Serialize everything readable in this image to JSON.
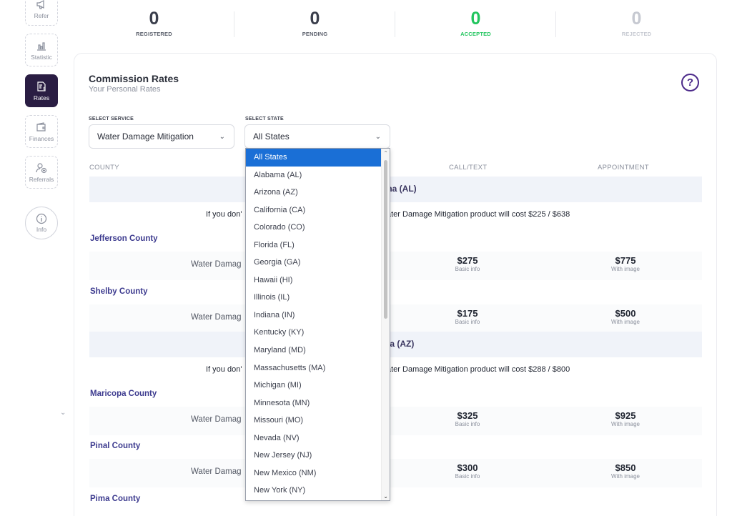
{
  "sidebar": {
    "items": [
      {
        "label": "Refer",
        "icon": "megaphone-icon"
      },
      {
        "label": "Statistic",
        "icon": "bar-chart-icon"
      },
      {
        "label": "Rates",
        "icon": "invoice-dollar-icon"
      },
      {
        "label": "Finances",
        "icon": "wallet-icon"
      },
      {
        "label": "Referrals",
        "icon": "user-add-icon"
      }
    ],
    "info_label": "Info",
    "collapse_glyph": "⌄"
  },
  "stats": [
    {
      "value": "0",
      "label": "REGISTERED"
    },
    {
      "value": "0",
      "label": "PENDING"
    },
    {
      "value": "0",
      "label": "ACCEPTED"
    },
    {
      "value": "0",
      "label": "REJECTED"
    }
  ],
  "colors": {
    "accent": "#2a1d43",
    "accepted": "#22c55e",
    "county_link": "#3d3b8f",
    "dropdown_selected": "#1a6fd6"
  },
  "card": {
    "title": "Commission Rates",
    "subtitle": "Your Personal Rates",
    "help": "?"
  },
  "filters": {
    "service_label": "SELECT SERVICE",
    "service_value": "Water Damage Mitigation",
    "state_label": "SELECT STATE",
    "state_value": "All States"
  },
  "table": {
    "headers": {
      "county": "COUNTY",
      "call": "CALL/TEXT",
      "appointment": "APPOINTMENT"
    },
    "state1": {
      "name": "ma (AL)",
      "note_left": "If you don'",
      "note_right": "ater Damage Mitigation product will cost $225 / $638",
      "counties": [
        {
          "name": "Jefferson County",
          "service": "Water Damag",
          "call": "$275",
          "call_sub": "Basic info",
          "appt": "$775",
          "appt_sub": "With image"
        },
        {
          "name": "Shelby County",
          "service": "Water Damag",
          "call": "$175",
          "call_sub": "Basic info",
          "appt": "$500",
          "appt_sub": "With image"
        }
      ]
    },
    "state2": {
      "name": "na (AZ)",
      "note_left": "If you don'",
      "note_right": "ater Damage Mitigation product will cost $288 / $800",
      "counties": [
        {
          "name": "Maricopa County",
          "service": "Water Damag",
          "call": "$325",
          "call_sub": "Basic info",
          "appt": "$925",
          "appt_sub": "With image"
        },
        {
          "name": "Pinal County",
          "service": "Water Damag",
          "call": "$300",
          "call_sub": "Basic info",
          "appt": "$850",
          "appt_sub": "With image"
        },
        {
          "name": "Pima County"
        }
      ]
    }
  },
  "dropdown": {
    "options": [
      "All States",
      "Alabama (AL)",
      "Arizona (AZ)",
      "California (CA)",
      "Colorado (CO)",
      "Florida (FL)",
      "Georgia (GA)",
      "Hawaii (HI)",
      "Illinois (IL)",
      "Indiana (IN)",
      "Kentucky (KY)",
      "Maryland (MD)",
      "Massachusetts (MA)",
      "Michigan (MI)",
      "Minnesota (MN)",
      "Missouri (MO)",
      "Nevada (NV)",
      "New Jersey (NJ)",
      "New Mexico (NM)",
      "New York (NY)"
    ],
    "selected": "All States"
  }
}
